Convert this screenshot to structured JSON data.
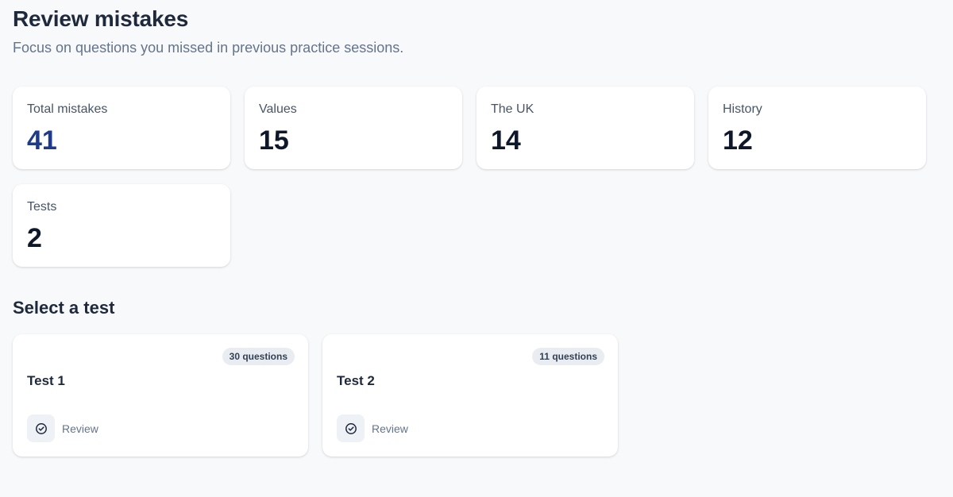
{
  "header": {
    "title": "Review mistakes",
    "subtitle": "Focus on questions you missed in previous practice sessions."
  },
  "stats": [
    {
      "label": "Total mistakes",
      "value": "41"
    },
    {
      "label": "Values",
      "value": "15"
    },
    {
      "label": "The UK",
      "value": "14"
    },
    {
      "label": "History",
      "value": "12"
    },
    {
      "label": "Tests",
      "value": "2"
    }
  ],
  "tests_section": {
    "title": "Select a test",
    "tests": [
      {
        "name": "Test 1",
        "questions": "30 questions",
        "action": "Review",
        "icon": "check-circle-icon"
      },
      {
        "name": "Test 2",
        "questions": "11 questions",
        "action": "Review",
        "icon": "check-circle-icon"
      }
    ]
  },
  "colors": {
    "background": "#f8f9fb",
    "accent_value": "#1e3a8a",
    "text_primary": "#1e293b",
    "text_muted": "#64748b"
  }
}
